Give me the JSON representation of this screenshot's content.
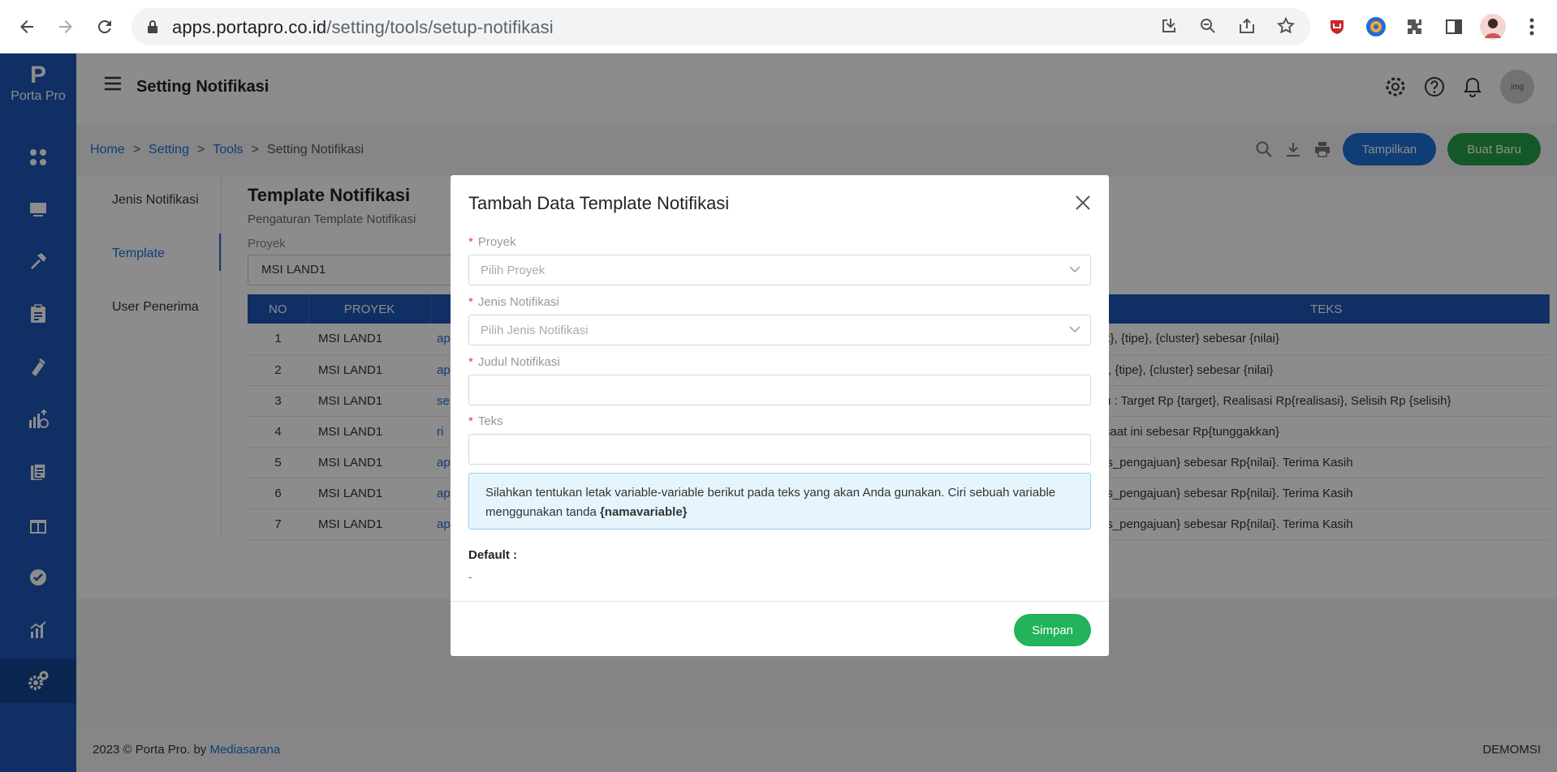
{
  "browser": {
    "url_domain": "apps.portapro.co.id",
    "url_path": "/setting/tools/setup-notifikasi"
  },
  "sidebar": {
    "logo_mark": "P",
    "logo_text": "Porta Pro"
  },
  "header": {
    "title": "Setting Notifikasi",
    "avatar_text": "img"
  },
  "breadcrumb": {
    "items": [
      "Home",
      "Setting",
      "Tools",
      "Setting Notifikasi"
    ],
    "separator": ">"
  },
  "actions": {
    "tampilkan": "Tampilkan",
    "buat_baru": "Buat Baru"
  },
  "subnav": {
    "items": [
      "Jenis Notifikasi",
      "Template",
      "User Penerima"
    ],
    "active": "Template"
  },
  "section": {
    "title": "Template Notifikasi",
    "subtitle": "Pengaturan Template Notifikasi",
    "proyek_label": "Proyek",
    "proyek_value": "MSI LAND1"
  },
  "table": {
    "headers": [
      "NO",
      "PROYEK",
      "",
      "TEKS"
    ],
    "rows": [
      {
        "no": "1",
        "proyek": "MSI LAND1",
        "col3": "ap",
        "teks": "k}, {tipe}, {cluster} sebesar {nilai}"
      },
      {
        "no": "2",
        "proyek": "MSI LAND1",
        "col3": "ap",
        "teks": "}, {tipe}, {cluster} sebesar {nilai}"
      },
      {
        "no": "3",
        "proyek": "MSI LAND1",
        "col3": "se",
        "teks": "u : Target Rp {target}, Realisasi Rp{realisasi}, Selisih Rp {selisih}"
      },
      {
        "no": "4",
        "proyek": "MSI LAND1",
        "col3": "ri",
        "teks": "saat ini sebesar Rp{tunggakkan}"
      },
      {
        "no": "5",
        "proyek": "MSI LAND1",
        "col3": "ap",
        "teks": "is_pengajuan} sebesar Rp{nilai}. Terima Kasih"
      },
      {
        "no": "6",
        "proyek": "MSI LAND1",
        "col3": "ap",
        "teks": "is_pengajuan} sebesar Rp{nilai}. Terima Kasih"
      },
      {
        "no": "7",
        "proyek": "MSI LAND1",
        "col3": "ap",
        "teks": "is_pengajuan} sebesar Rp{nilai}. Terima Kasih"
      }
    ]
  },
  "footer": {
    "copyright": "2023 © Porta Pro. by ",
    "company": "Mediasarana",
    "user": "DEMOMSI"
  },
  "modal": {
    "title": "Tambah Data Template Notifikasi",
    "required_mark": "*",
    "proyek_label": "Proyek",
    "proyek_placeholder": "Pilih Proyek",
    "jenis_label": "Jenis Notifikasi",
    "jenis_placeholder": "Pilih Jenis Notifikasi",
    "judul_label": "Judul Notifikasi",
    "judul_value": "",
    "teks_label": "Teks",
    "teks_value": "",
    "info_text": "Silahkan tentukan letak variable-variable berikut pada teks yang akan Anda gunakan. Ciri sebuah variable menggunakan tanda ",
    "info_bold": "{namavariable}",
    "default_label": "Default :",
    "default_value": "-",
    "save_label": "Simpan"
  },
  "colors": {
    "sidebar": "#1d56b8",
    "primary": "#1d6fd8",
    "green": "#27a047",
    "save": "#22b35b"
  }
}
